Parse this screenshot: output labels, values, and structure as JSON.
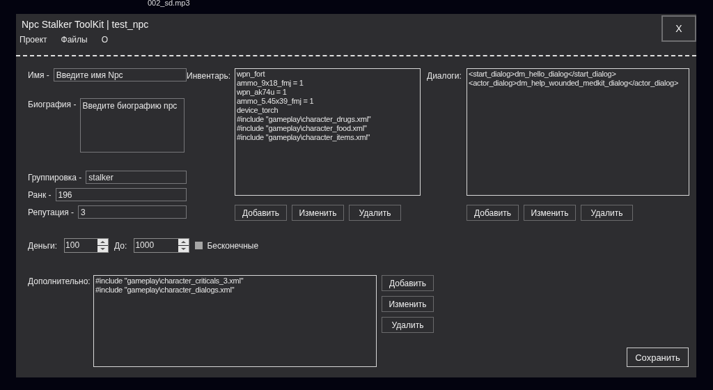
{
  "background_file": "002_sd.mp3",
  "window": {
    "title": "Npc Stalker ToolKit | test_npc",
    "close": "X"
  },
  "menu": [
    "Проект",
    "Файлы",
    "О"
  ],
  "fields": [
    {
      "kind": "text",
      "label": "Имя -",
      "value": "Введите имя Npc"
    },
    {
      "kind": "textarea",
      "label": "Биография -",
      "value": "Введите биографию npc"
    },
    {
      "kind": "text",
      "label": "Группировка -",
      "value": "stalker"
    },
    {
      "kind": "text",
      "label": "Ранк -",
      "value": "196"
    },
    {
      "kind": "text",
      "label": "Репутация -",
      "value": "3"
    }
  ],
  "inventory": {
    "label": "Инвентарь:",
    "items": [
      "wpn_fort",
      "ammo_9x18_fmj = 1",
      "wpn_ak74u = 1",
      "ammo_5.45x39_fmj = 1",
      "device_torch",
      "#include \"gameplay\\character_drugs.xml\"",
      "#include \"gameplay\\character_food.xml\"",
      "#include \"gameplay\\character_items.xml\""
    ],
    "buttons": [
      "Добавить",
      "Изменить",
      "Удалить"
    ]
  },
  "dialogs": {
    "label": "Диалоги:",
    "items": [
      "<start_dialog>dm_hello_dialog</start_dialog>",
      "<actor_dialog>dm_help_wounded_medkit_dialog</actor_dialog>"
    ],
    "buttons": [
      "Добавить",
      "Изменить",
      "Удалить"
    ]
  },
  "money": {
    "label": "Деньги:",
    "value": "100",
    "to_label": "До:",
    "to_value": "1000",
    "infinite": {
      "label": "Бесконечные",
      "checked": false
    }
  },
  "extra": {
    "label": "Дополнительно:",
    "items": [
      "#include \"gameplay\\character_criticals_3.xml\"",
      "#include \"gameplay\\character_dialogs.xml\""
    ],
    "buttons": [
      "Добавить",
      "Изменить",
      "Удалить"
    ]
  },
  "save": "Сохранить"
}
